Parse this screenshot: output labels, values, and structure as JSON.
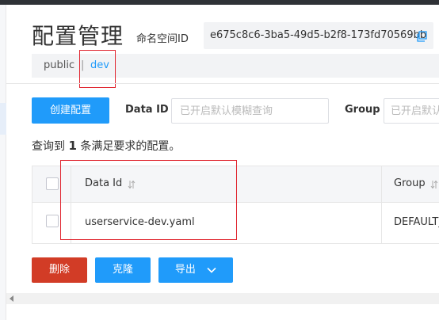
{
  "header": {
    "title": "配置管理",
    "namespace_label": "命名空间ID",
    "namespace_id": "e675c8c6-3ba5-49d5-b2f8-173fd70569bb"
  },
  "namespace_tabs": {
    "items": [
      "public",
      "dev"
    ],
    "separator": "|",
    "active": "dev"
  },
  "toolbar": {
    "create_label": "创建配置",
    "data_id_label": "Data ID",
    "data_id_placeholder": "已开启默认模糊查询",
    "group_label": "Group",
    "group_placeholder": "已开启默认模糊查询"
  },
  "result": {
    "prefix": "查询到",
    "count": "1",
    "suffix": "条满足要求的配置。"
  },
  "table": {
    "columns": [
      "Data Id",
      "Group"
    ],
    "rows": [
      {
        "data_id": "userservice-dev.yaml",
        "group": "DEFAULT_"
      }
    ]
  },
  "actions": {
    "delete_label": "删除",
    "clone_label": "克隆",
    "export_label": "导出"
  },
  "colors": {
    "primary": "#209bfa",
    "danger": "#d23c26",
    "highlight_box": "#e0242e"
  }
}
